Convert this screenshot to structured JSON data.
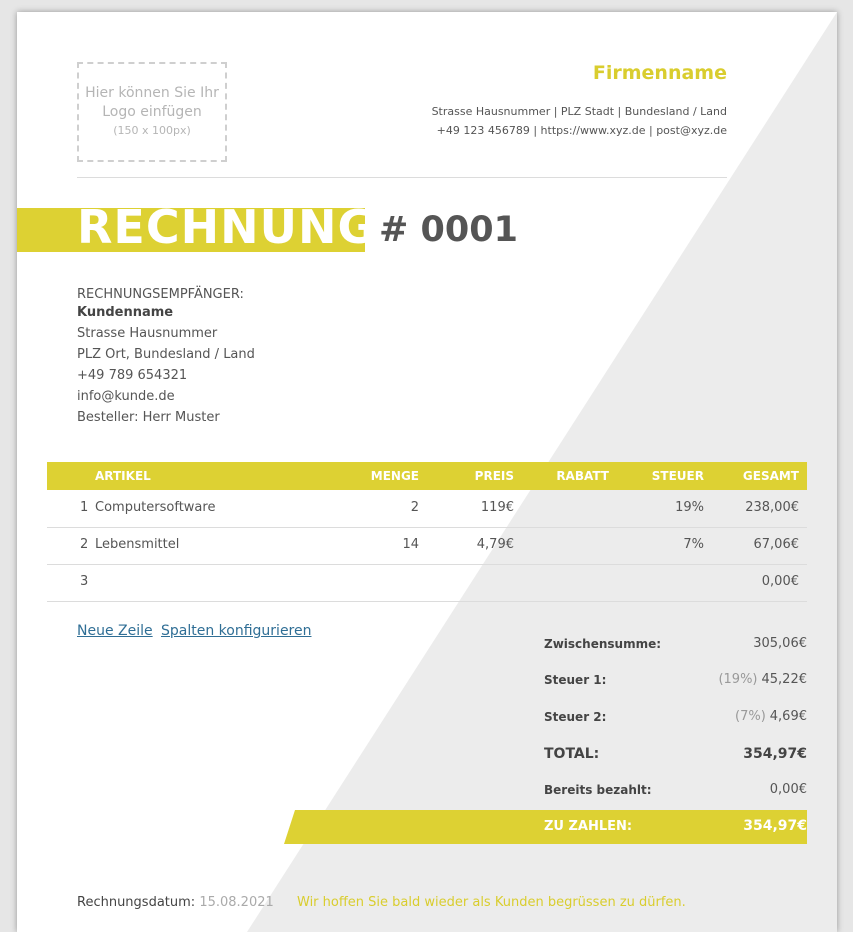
{
  "colors": {
    "accent": "#ddd133",
    "diagonal": "#ececec",
    "link": "#2f6e95",
    "text": "#444444"
  },
  "logo": {
    "line1": "Hier können Sie Ihr",
    "line2": "Logo einfügen",
    "size": "(150 x 100px)"
  },
  "company": {
    "name": "Firmenname",
    "address": "Strasse Hausnummer | PLZ Stadt | Bundesland / Land",
    "contact": "+49 123 456789 | https://www.xyz.de | post@xyz.de"
  },
  "invoice": {
    "title": "RECHNUNG",
    "number": "# 0001"
  },
  "recipient": {
    "heading": "RECHNUNGSEMPFÄNGER:",
    "name": "Kundenname",
    "street": "Strasse Hausnummer",
    "city": "PLZ Ort, Bundesland / Land",
    "phone": "+49 789 654321",
    "email": "info@kunde.de",
    "orderer": "Besteller: Herr Muster"
  },
  "table": {
    "headers": {
      "item": "ARTIKEL",
      "qty": "MENGE",
      "price": "PREIS",
      "discount": "RABATT",
      "tax": "STEUER",
      "total": "GESAMT"
    },
    "rows": [
      {
        "num": "1",
        "item": "Computersoftware",
        "qty": "2",
        "price": "119€",
        "discount": "",
        "tax": "19%",
        "total": "238,00€"
      },
      {
        "num": "2",
        "item": "Lebensmittel",
        "qty": "14",
        "price": "4,79€",
        "discount": "",
        "tax": "7%",
        "total": "67,06€"
      },
      {
        "num": "3",
        "item": "",
        "qty": "",
        "price": "",
        "discount": "",
        "tax": "",
        "total": "0,00€"
      }
    ]
  },
  "actions": {
    "new_row": "Neue Zeile",
    "configure_columns": "Spalten konfigurieren"
  },
  "summary": {
    "subtotal_label": "Zwischensumme:",
    "subtotal": "305,06€",
    "tax1_label": "Steuer 1:",
    "tax1_rate": "(19%)",
    "tax1": "45,22€",
    "tax2_label": "Steuer 2:",
    "tax2_rate": "(7%)",
    "tax2": "4,69€",
    "total_label": "TOTAL:",
    "total": "354,97€",
    "paid_label": "Bereits bezahlt:",
    "paid": "0,00€",
    "due_label": "ZU ZAHLEN:",
    "due": "354,97€"
  },
  "footer": {
    "date_label": "Rechnungsdatum:",
    "date": "15.08.2021",
    "message": "Wir hoffen Sie bald wieder als Kunden begrüssen zu dürfen."
  }
}
